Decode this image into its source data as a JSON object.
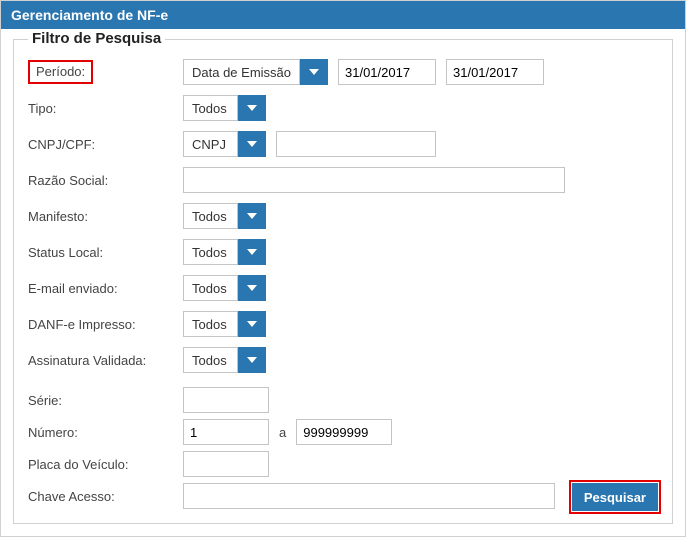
{
  "window": {
    "title": "Gerenciamento de NF-e"
  },
  "panel": {
    "legend": "Filtro de Pesquisa"
  },
  "labels": {
    "periodo": "Período:",
    "tipo": "Tipo:",
    "cnpjcpf": "CNPJ/CPF:",
    "razao": "Razão Social:",
    "manifesto": "Manifesto:",
    "statuslocal": "Status Local:",
    "email": "E-mail enviado:",
    "danfe": "DANF-e Impresso:",
    "assinatura": "Assinatura Validada:",
    "serie": "Série:",
    "numero": "Número:",
    "numero_sep": "a",
    "placa": "Placa do Veículo:",
    "chave": "Chave Acesso:"
  },
  "values": {
    "periodo_tipo": "Data de Emissão",
    "periodo_de": "31/01/2017",
    "periodo_ate": "31/01/2017",
    "tipo": "Todos",
    "cnpjcpf": "CNPJ",
    "cnpjcpf_val": "",
    "razao": "",
    "manifesto": "Todos",
    "statuslocal": "Todos",
    "email": "Todos",
    "danfe": "Todos",
    "assinatura": "Todos",
    "serie": "",
    "numero_de": "1",
    "numero_ate": "999999999",
    "placa": "",
    "chave": ""
  },
  "buttons": {
    "pesquisar": "Pesquisar"
  }
}
